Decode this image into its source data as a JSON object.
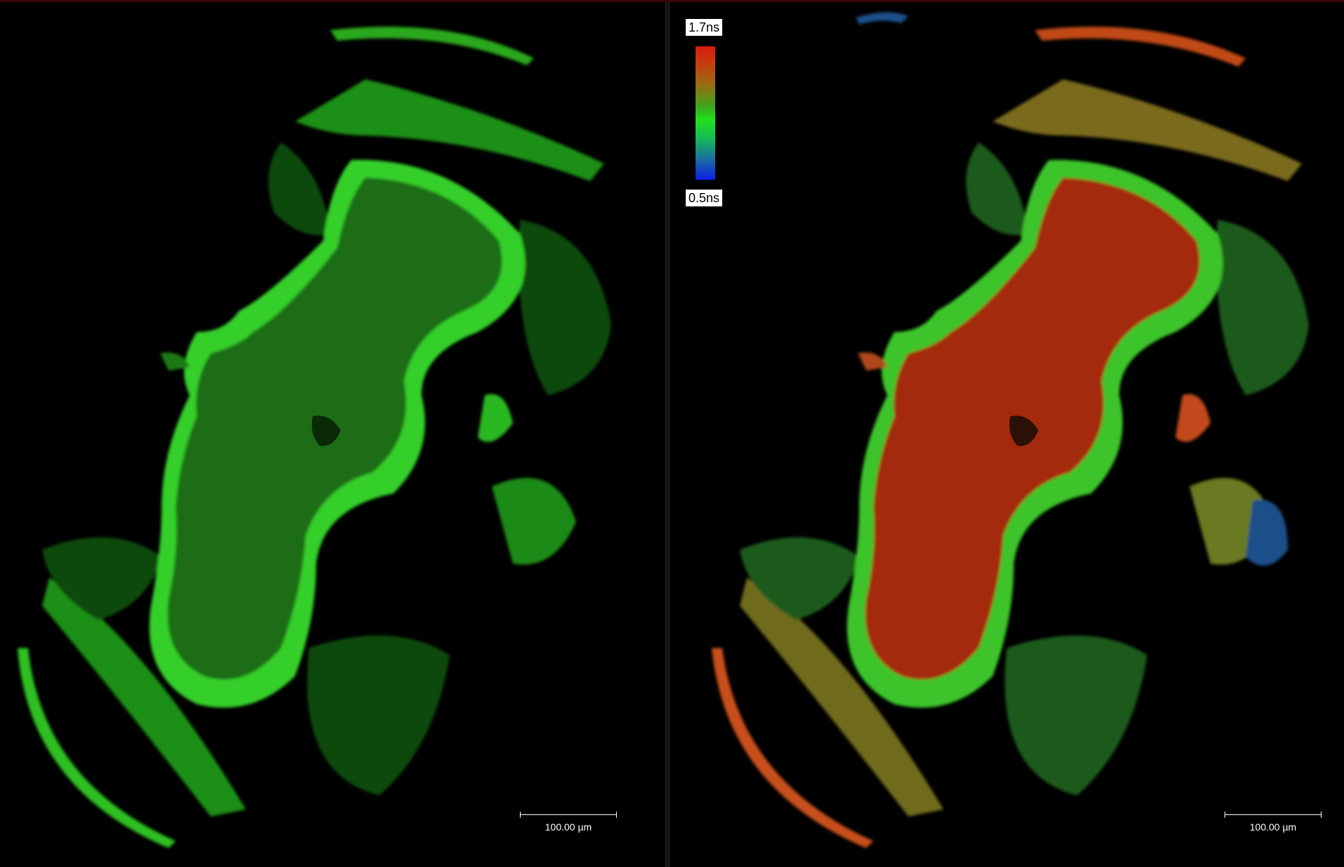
{
  "left_image": {
    "scalebar_label": "100.00 µm"
  },
  "right_image": {
    "scalebar_label": "100.00 µm",
    "colorbar": {
      "max_label": "1.7ns",
      "min_label": "0.5ns",
      "colors": [
        "#d81a0e",
        "#9a6a12",
        "#1fe21c",
        "#1a6aa0",
        "#0c1fe6"
      ]
    }
  },
  "colors": {
    "left_tissue": "#1c7a14",
    "left_bright": "#35d62a",
    "right_core": "#a42a10",
    "right_border": "#38c92a",
    "right_edge_blue": "#1d4f8a"
  }
}
